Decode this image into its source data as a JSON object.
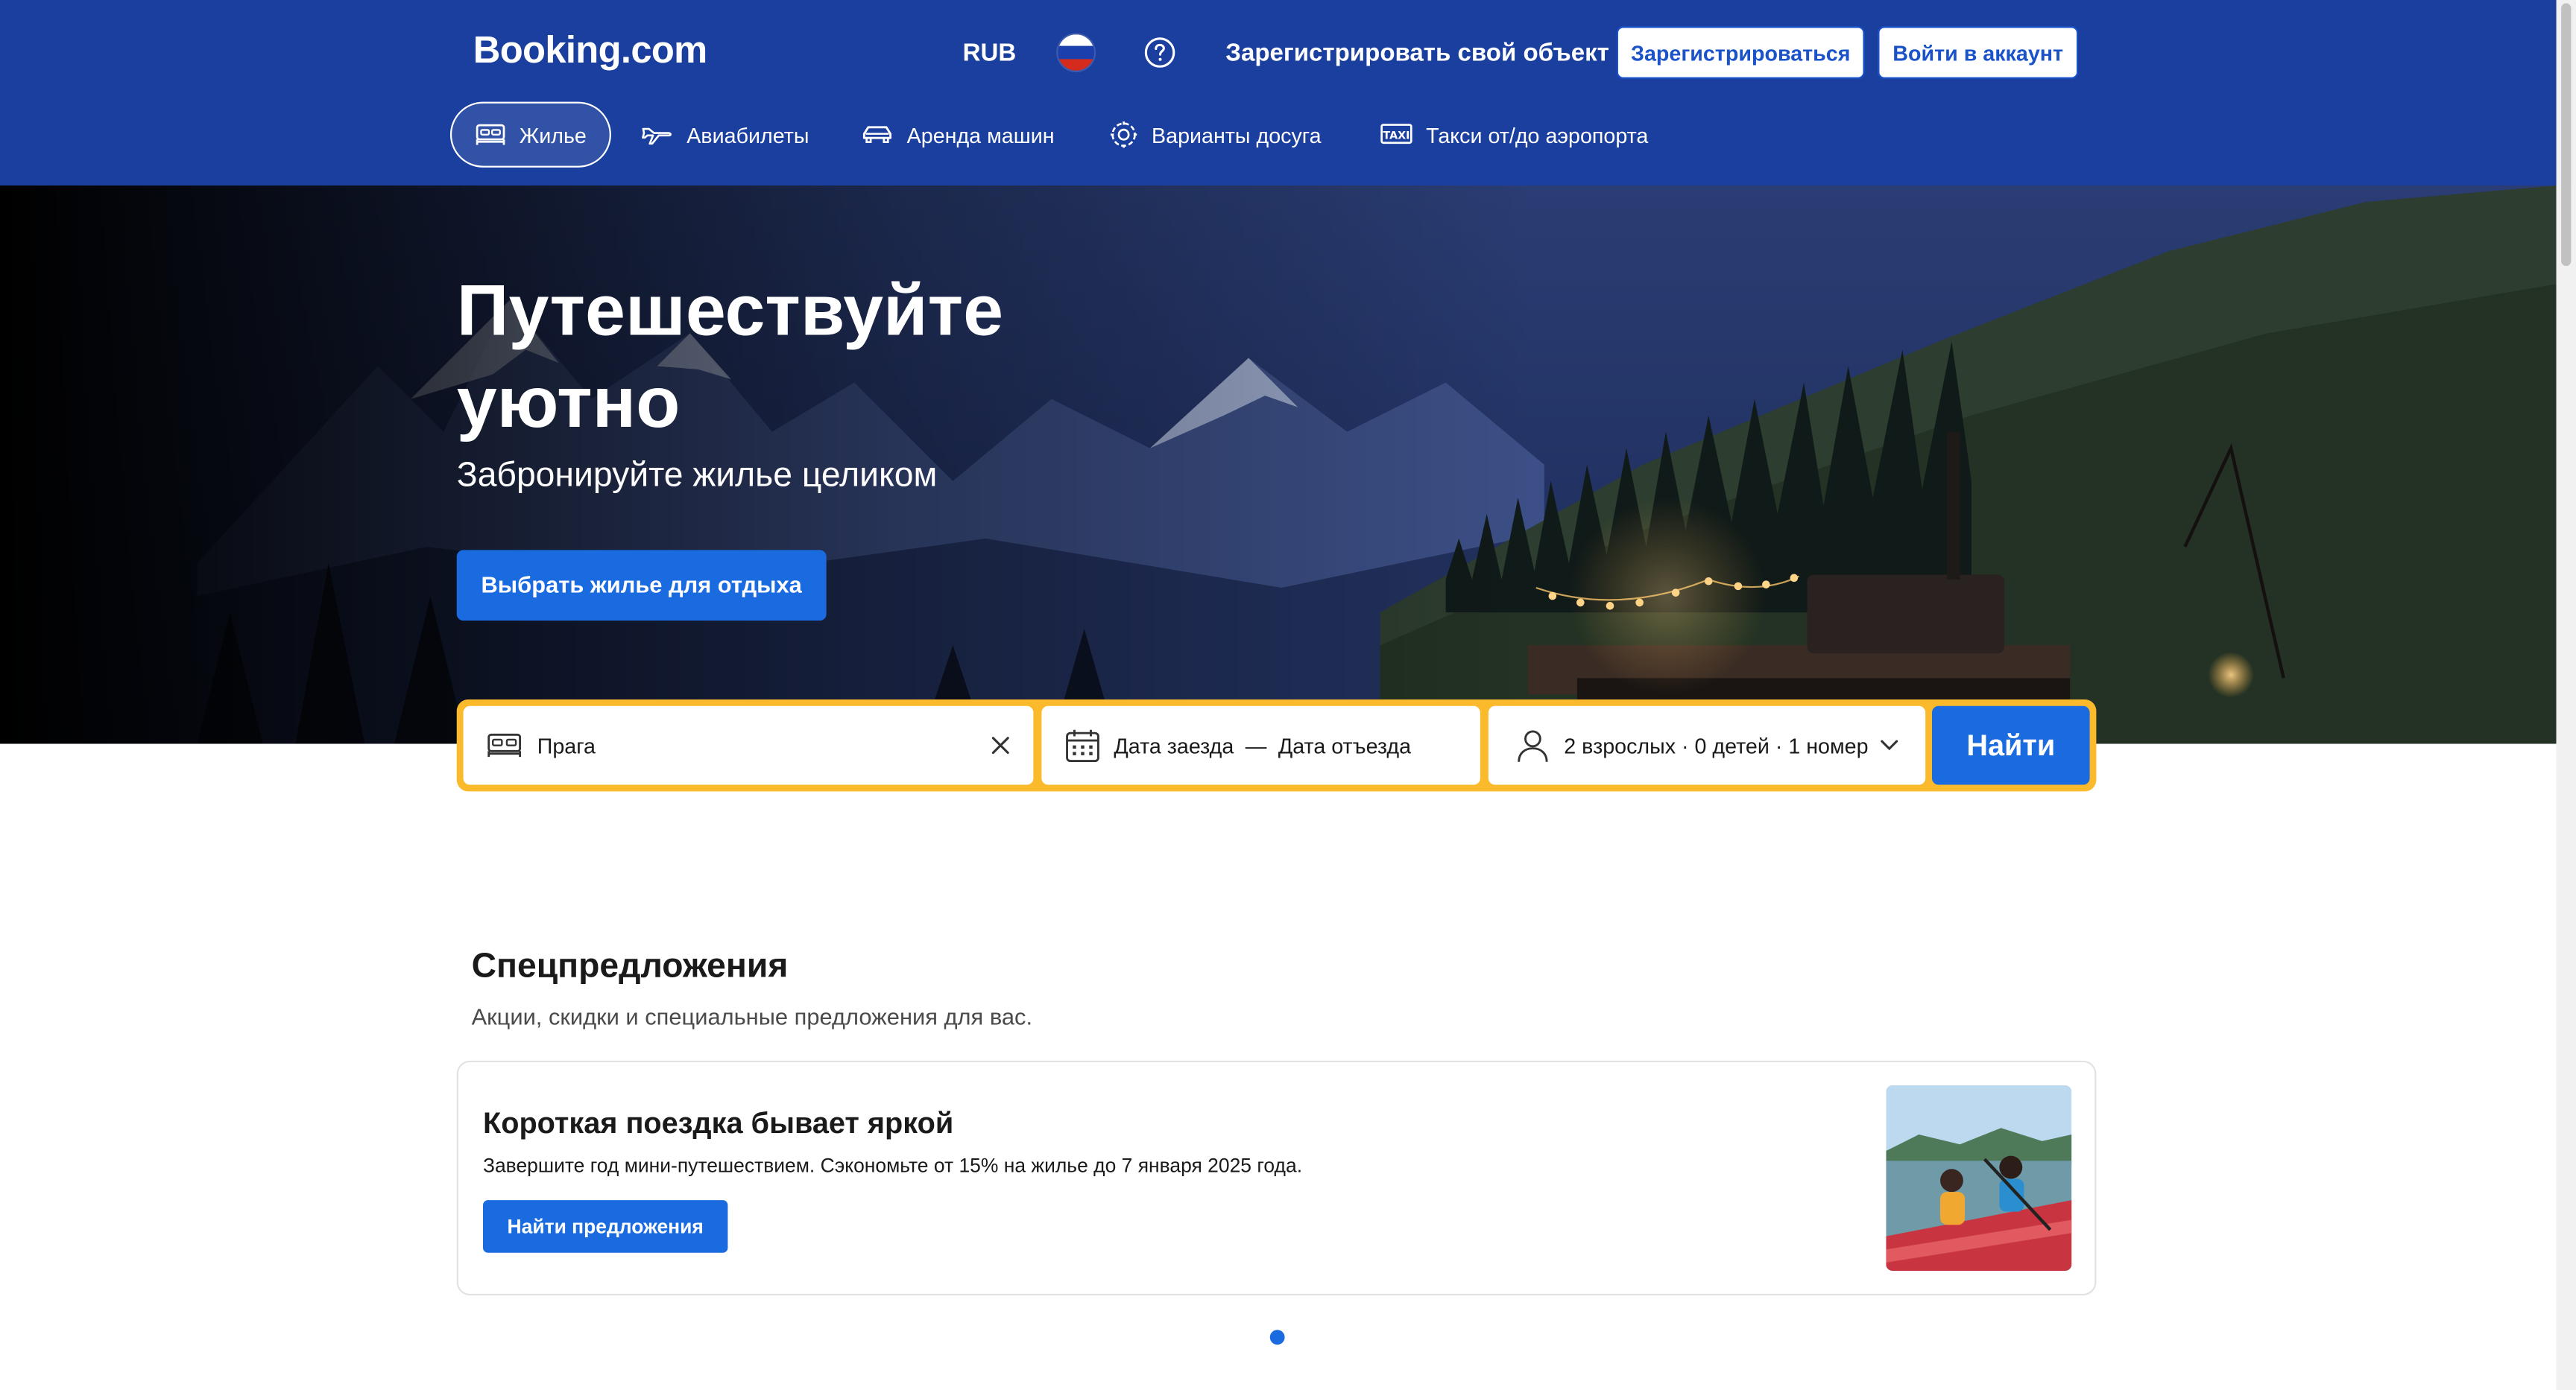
{
  "header": {
    "logo": "Booking.com",
    "currency": "RUB",
    "language_flag": "russia-flag",
    "help_icon": "help-circle-icon",
    "list_property": "Зарегистрировать свой объект",
    "register": "Зарегистрироваться",
    "sign_in": "Войти в аккаунт"
  },
  "nav": {
    "items": [
      {
        "label": "Жилье",
        "icon": "bed-icon",
        "active": true
      },
      {
        "label": "Авиабилеты",
        "icon": "plane-icon",
        "active": false
      },
      {
        "label": "Аренда машин",
        "icon": "car-icon",
        "active": false
      },
      {
        "label": "Варианты досуга",
        "icon": "attractions-icon",
        "active": false
      },
      {
        "label": "Такси от/до аэропорта",
        "icon": "taxi-icon",
        "active": false
      }
    ]
  },
  "hero": {
    "title": "Путешествуйте уютно",
    "subtitle": "Забронируйте жилье целиком",
    "cta": "Выбрать жилье для отдыха"
  },
  "search": {
    "destination": "Прага",
    "checkin": "Дата заезда",
    "separator": "—",
    "checkout": "Дата отъезда",
    "guests": "2 взрослых · 0 детей · 1 номер",
    "submit": "Найти"
  },
  "offers": {
    "title": "Спецпредложения",
    "subtitle": "Акции, скидки и специальные предложения для вас.",
    "card": {
      "title": "Короткая поездка бывает яркой",
      "text": "Завершите год мини-путешествием. Сэкономьте от 15% на жилье до 7 января 2025 года.",
      "button": "Найти предложения"
    }
  },
  "colors": {
    "brand_blue": "#1a3f9e",
    "action_blue": "#1a6be0",
    "search_border": "#fbb92c"
  }
}
